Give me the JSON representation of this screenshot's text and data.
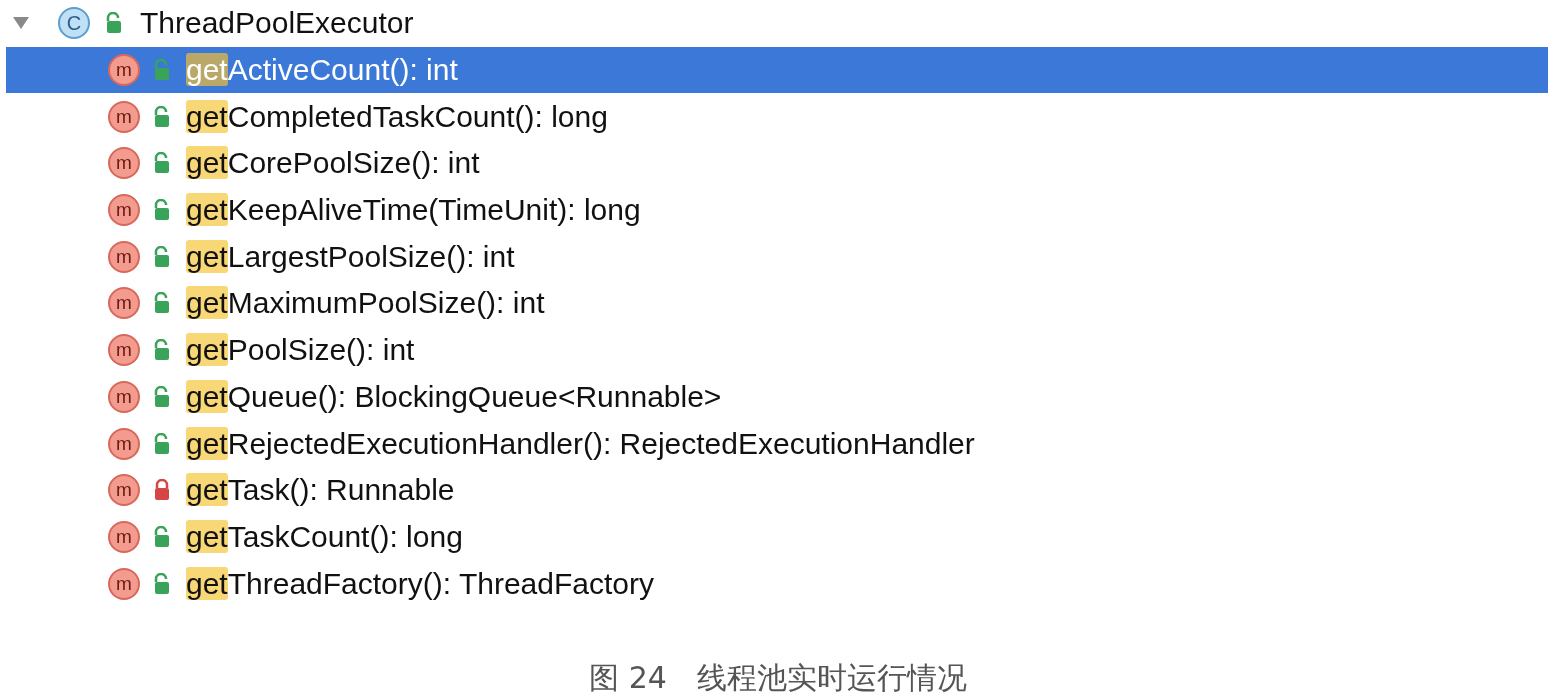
{
  "tree": {
    "expanded": true,
    "root": {
      "label": "ThreadPoolExecutor",
      "icon_letter": "C",
      "locked": false
    },
    "items": [
      {
        "match": "get",
        "rest": "ActiveCount(): int",
        "icon_letter": "m",
        "locked": false,
        "selected": true
      },
      {
        "match": "get",
        "rest": "CompletedTaskCount(): long",
        "icon_letter": "m",
        "locked": false,
        "selected": false
      },
      {
        "match": "get",
        "rest": "CorePoolSize(): int",
        "icon_letter": "m",
        "locked": false,
        "selected": false
      },
      {
        "match": "get",
        "rest": "KeepAliveTime(TimeUnit): long",
        "icon_letter": "m",
        "locked": false,
        "selected": false
      },
      {
        "match": "get",
        "rest": "LargestPoolSize(): int",
        "icon_letter": "m",
        "locked": false,
        "selected": false
      },
      {
        "match": "get",
        "rest": "MaximumPoolSize(): int",
        "icon_letter": "m",
        "locked": false,
        "selected": false
      },
      {
        "match": "get",
        "rest": "PoolSize(): int",
        "icon_letter": "m",
        "locked": false,
        "selected": false
      },
      {
        "match": "get",
        "rest": "Queue(): BlockingQueue<Runnable>",
        "icon_letter": "m",
        "locked": false,
        "selected": false
      },
      {
        "match": "get",
        "rest": "RejectedExecutionHandler(): RejectedExecutionHandler",
        "icon_letter": "m",
        "locked": false,
        "selected": false
      },
      {
        "match": "get",
        "rest": "Task(): Runnable",
        "icon_letter": "m",
        "locked": true,
        "selected": false
      },
      {
        "match": "get",
        "rest": "TaskCount(): long",
        "icon_letter": "m",
        "locked": false,
        "selected": false
      },
      {
        "match": "get",
        "rest": "ThreadFactory(): ThreadFactory",
        "icon_letter": "m",
        "locked": false,
        "selected": false
      }
    ]
  },
  "caption": "图 24　线程池实时运行情况"
}
